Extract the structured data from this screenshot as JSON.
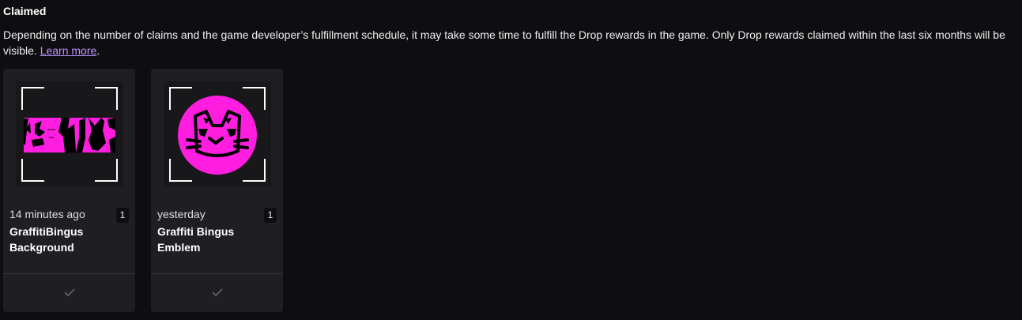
{
  "section": {
    "title": "Claimed",
    "description": "Depending on the number of claims and the game developer’s fulfillment schedule, it may take some time to fulfill the Drop rewards in the game. Only Drop rewards claimed within the last six months will be visible. ",
    "learn_more": "Learn more",
    "period": "."
  },
  "rewards": [
    {
      "time": "14 minutes ago",
      "name": "GraffitiBingus Background",
      "quantity": "1",
      "image_icon": "graffiti-background-image",
      "status_icon": "check-icon"
    },
    {
      "time": "yesterday",
      "name": "Graffiti Bingus Emblem",
      "quantity": "1",
      "image_icon": "cat-emblem-image",
      "status_icon": "check-icon"
    }
  ],
  "colors": {
    "background": "#0e0e10",
    "card": "#1f1f23",
    "link": "#bf94ff",
    "accent_pink": "#ff1ee0"
  }
}
